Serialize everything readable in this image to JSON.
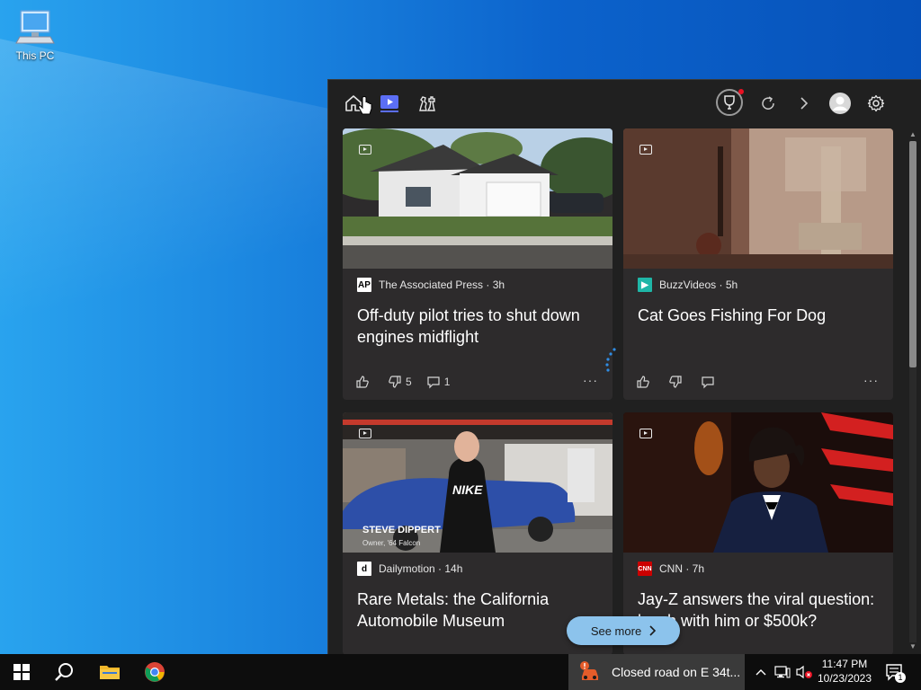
{
  "desktop": {
    "icon_label": "This PC"
  },
  "widget": {
    "nav": {
      "home_icon": "home-icon",
      "video_icon": "play-icon",
      "games_icon": "chess-icon"
    },
    "scroll_fraction": 0.0
  },
  "cards": [
    {
      "source": "The Associated Press · 3h",
      "logo_text": "AP",
      "title": "Off-duty pilot tries to shut down engines midflight",
      "dislikes": "5",
      "comments": "1"
    },
    {
      "source": "BuzzVideos · 5h",
      "logo_text": "▶",
      "title": "Cat Goes Fishing For Dog"
    },
    {
      "source": "Dailymotion · 14h",
      "logo_text": "d",
      "title": "Rare Metals: the California Automobile Museum",
      "image_caption": "STEVE DIPPERT",
      "image_caption2": "Owner, '64 Falcon",
      "shirt_text": "NIKE"
    },
    {
      "source": "CNN · 7h",
      "logo_text": "CNN",
      "title": "Jay-Z answers the viral question: lunch with him or $500k?"
    }
  ],
  "see_more": {
    "label": "See more"
  },
  "more_label": "···",
  "taskbar": {
    "notification_text": "Closed road on E 34t...",
    "time": "11:47 PM",
    "date": "10/23/2023",
    "notification_count": "1"
  },
  "colors": {
    "accent": "#5b6ef5",
    "panel_bg": "#202020",
    "card_bg": "#2d2b2c",
    "see_more_bg": "#8cc3ec",
    "trophy_badge": "#e81123"
  }
}
